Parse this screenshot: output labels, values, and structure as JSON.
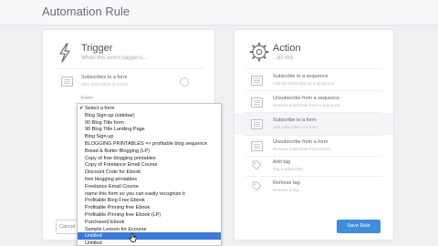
{
  "page_title": "Automation Rule",
  "trigger": {
    "title": "Trigger",
    "subtitle": "When this event happens...",
    "option_label": "Subscribes to a form",
    "option_sub": "User subscribes to a form",
    "form_label": "Form"
  },
  "action": {
    "title": "Action",
    "subtitle": "...do this",
    "options": [
      {
        "label": "Subscribe to a sequence",
        "sub": "Add the subscriber to a sequence",
        "icon": "list-icon"
      },
      {
        "label": "Unsubscribe from a sequence",
        "sub": "Remove subscriber from a sequence",
        "icon": "list-icon"
      },
      {
        "label": "Subscribe to a form",
        "sub": "Add subscriber to a form",
        "icon": "list-icon"
      },
      {
        "label": "Unsubscribe from a form",
        "sub": "Remove subscriber from a form",
        "icon": "list-icon"
      },
      {
        "label": "Add tag",
        "sub": "Tag a subscriber",
        "icon": "tag-icon"
      },
      {
        "label": "Remove tag",
        "sub": "Remove a tag",
        "icon": "tag-icon"
      }
    ]
  },
  "buttons": {
    "cancel": "Cancel",
    "save": "Save Rule"
  },
  "dropdown": {
    "items": [
      "Select a form",
      "Blog Sign-up (sidebar)",
      "90 Blog Title form",
      "90 Blog Title Landing Page",
      "Blog Sign-up",
      "BLOGGING PRINTABLES => profitable blog sequence",
      "Bread & Butter Blogging (LP)",
      "Copy of free blogging printables",
      "Copy of Freelance Email Course",
      "Discount Code for Ebook",
      "free blogging printables",
      "Freelance Email Course",
      "name this form so you can easily recognize it",
      "Profitable Blog Free Ebook",
      "Profitable Pinning free Ebook",
      "Profitable Pinning free Ebook (LP)",
      "Purchased Ebook",
      "Sample Lesson for Ecourse",
      "Untitled",
      "Untitled"
    ],
    "checked_index": 0,
    "selected_index": 18
  },
  "colors": {
    "primary": "#3d8fd8",
    "highlight": "#3b7ad9",
    "background": "#eef0f2"
  }
}
